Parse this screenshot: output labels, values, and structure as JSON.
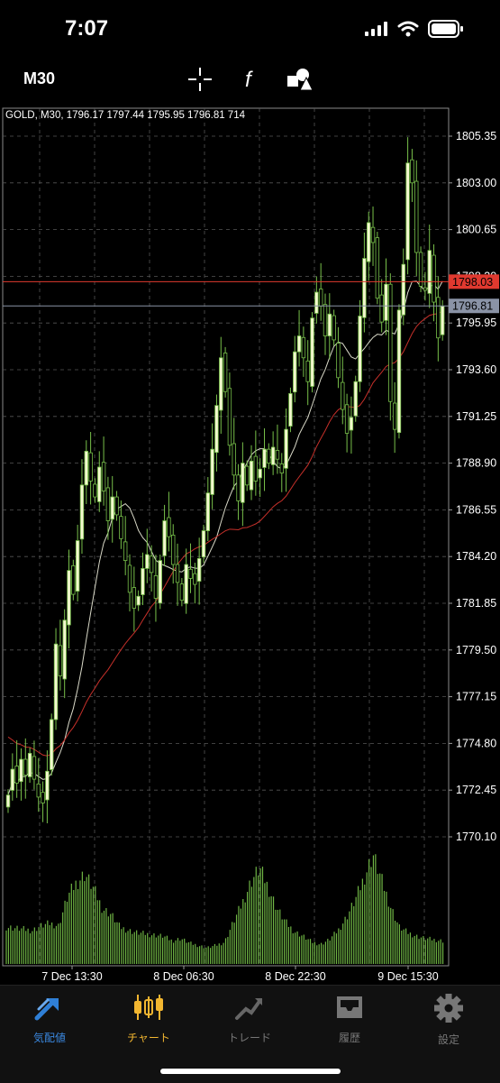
{
  "status": {
    "time": "7:07"
  },
  "toolbar": {
    "timeframe": "M30",
    "crosshair_icon": "crosshair-icon",
    "indicator_icon": "function-icon",
    "objects_icon": "shapes-icon"
  },
  "chart_data": {
    "type": "candlestick",
    "header": "GOLD, M30, 1796.17 1797.44 1795.95 1796.81 714",
    "symbol": "GOLD",
    "timeframe": "M30",
    "ohlc_current": {
      "open": 1796.17,
      "high": 1797.44,
      "low": 1795.95,
      "close": 1796.81,
      "volume": 714
    },
    "price_axis": [
      "1805.35",
      "1803.00",
      "1800.65",
      "1798.30",
      "1795.95",
      "1793.60",
      "1791.25",
      "1788.90",
      "1786.55",
      "1784.20",
      "1781.85",
      "1779.50",
      "1777.15",
      "1774.80",
      "1772.45",
      "1770.10"
    ],
    "ylim": [
      1770.1,
      1805.35
    ],
    "time_axis": [
      "7 Dec 13:30",
      "8 Dec 06:30",
      "8 Dec 22:30",
      "9 Dec 15:30"
    ],
    "price_lines": [
      {
        "label": "1798.03",
        "value": 1798.03,
        "color": "#e0392f"
      },
      {
        "label": "1796.81",
        "value": 1796.81,
        "color": "#8a93a6"
      }
    ],
    "grid": true,
    "colors": {
      "bull": "#f3f8cf",
      "bear": "#000000",
      "wick": "#78c04a",
      "ma_fast": "#d9d9c8",
      "ma_slow": "#c6302a"
    },
    "closes": [
      1772.2,
      1773.5,
      1772.8,
      1774.0,
      1773.2,
      1774.3,
      1773.0,
      1772.1,
      1771.8,
      1773.4,
      1776.0,
      1779.8,
      1778.2,
      1781.0,
      1783.5,
      1782.3,
      1785.0,
      1787.8,
      1789.5,
      1788.0,
      1787.2,
      1788.7,
      1787.5,
      1786.0,
      1787.2,
      1786.3,
      1785.1,
      1784.0,
      1782.4,
      1781.6,
      1782.2,
      1783.6,
      1784.3,
      1783.4,
      1782.1,
      1784.0,
      1786.0,
      1785.2,
      1783.8,
      1782.9,
      1782.0,
      1783.8,
      1783.1,
      1782.8,
      1784.1,
      1785.5,
      1787.4,
      1789.6,
      1791.8,
      1794.2,
      1792.5,
      1789.8,
      1788.3,
      1787.0,
      1788.9,
      1787.8,
      1789.0,
      1788.0,
      1788.6,
      1789.6,
      1788.9,
      1789.7,
      1789.1,
      1788.4,
      1790.6,
      1792.4,
      1794.5,
      1795.3,
      1794.2,
      1793.0,
      1796.2,
      1797.5,
      1796.8,
      1795.3,
      1796.4,
      1795.1,
      1793.2,
      1791.6,
      1790.4,
      1791.2,
      1793.0,
      1796.3,
      1799.2,
      1801.0,
      1800.0,
      1797.2,
      1796.0,
      1797.9,
      1792.0,
      1790.6,
      1796.6,
      1798.9,
      1804.0,
      1803.0,
      1799.5,
      1797.8,
      1797.6,
      1799.6,
      1797.0,
      1795.2,
      1796.8
    ],
    "volume_profile": [
      0.32,
      0.31,
      0.3,
      0.29,
      0.33,
      0.35,
      0.33,
      0.58,
      0.7,
      0.78,
      0.65,
      0.48,
      0.43,
      0.32,
      0.29,
      0.27,
      0.26,
      0.25,
      0.24,
      0.2,
      0.22,
      0.18,
      0.16,
      0.14,
      0.16,
      0.19,
      0.36,
      0.52,
      0.71,
      0.83,
      0.66,
      0.48,
      0.36,
      0.28,
      0.24,
      0.19,
      0.17,
      0.21,
      0.29,
      0.41,
      0.56,
      0.75,
      0.95,
      0.72,
      0.5,
      0.32,
      0.27,
      0.24,
      0.22,
      0.21,
      0.2
    ]
  },
  "tabs": [
    {
      "label": "気配値",
      "icon": "quotes-icon",
      "active": false
    },
    {
      "label": "チャート",
      "icon": "chart-candles-icon",
      "active": true
    },
    {
      "label": "トレード",
      "icon": "trade-icon",
      "active": false
    },
    {
      "label": "履歴",
      "icon": "history-inbox-icon",
      "active": false
    },
    {
      "label": "設定",
      "icon": "gear-icon",
      "active": false
    }
  ]
}
